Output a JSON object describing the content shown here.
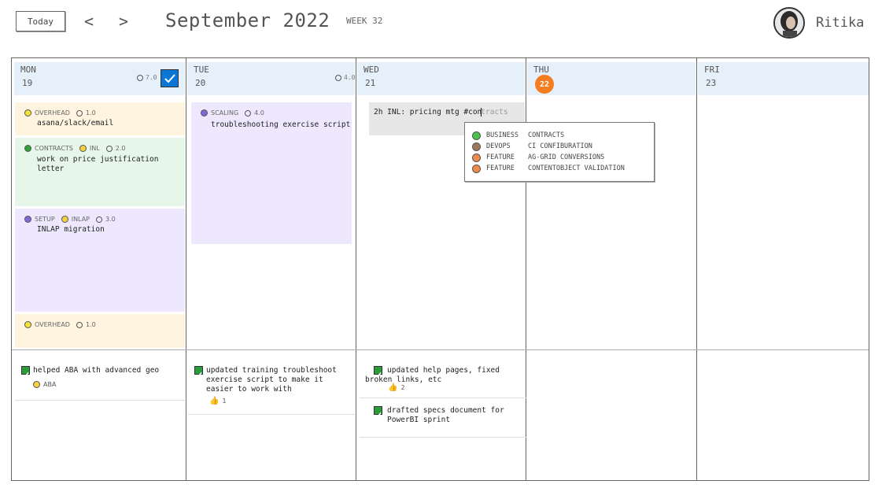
{
  "header": {
    "today_label": "Today",
    "prev_label": "<",
    "next_label": ">",
    "month_title": "September 2022",
    "week_label": "WEEK 32",
    "user_name": "Ritika"
  },
  "days": [
    {
      "name": "MON",
      "date": "19",
      "total": "7.0"
    },
    {
      "name": "TUE",
      "date": "20",
      "total": "4.0"
    },
    {
      "name": "WED",
      "date": "21"
    },
    {
      "name": "THU",
      "date": "22",
      "is_today": true
    },
    {
      "name": "FRI",
      "date": "23"
    }
  ],
  "tasks": {
    "mon": [
      {
        "tag": "OVERHEAD",
        "hours": "1.0",
        "title": "asana/slack/email",
        "color": "#f5e33a",
        "bg": "#fff4e0"
      },
      {
        "tag": "CONTRACTS",
        "person": "INL",
        "hours": "2.0",
        "title": "work on price justification letter",
        "color": "#2fa33a",
        "bg": "#e6f6e8"
      },
      {
        "tag": "SETUP",
        "person": "INLAP",
        "hours": "3.0",
        "title": "INLAP migration",
        "color": "#7d68d8",
        "bg": "#ede8fd"
      },
      {
        "tag": "OVERHEAD",
        "hours": "1.0",
        "color": "#f5e33a",
        "bg": "#fff4e0"
      }
    ],
    "tue": [
      {
        "tag": "SCALING",
        "hours": "4.0",
        "title": "troubleshooting exercise script",
        "color": "#7d68d8",
        "bg": "#ede8fd"
      }
    ]
  },
  "quick_entry": {
    "typed": "2h INL: pricing mtg #con",
    "completion": "tracts"
  },
  "suggestions": [
    {
      "category": "BUSINESS",
      "name": "CONTRACTS",
      "color": "#4cc24c"
    },
    {
      "category": "DEVOPS",
      "name": "CI CONFIBURATION",
      "color": "#a07858"
    },
    {
      "category": "FEATURE",
      "name": "AG-GRID CONVERSIONS",
      "color": "#f08a4a"
    },
    {
      "category": "FEATURE",
      "name": "CONTENTOBJECT VALIDATION",
      "color": "#f08a4a"
    }
  ],
  "done": {
    "mon": [
      {
        "text": "helped ABA with advanced geo",
        "person": "ABA"
      }
    ],
    "tue": [
      {
        "text": "updated training troubleshoot exercise script to make it easier to work with",
        "likes": "1"
      }
    ],
    "wed": [
      {
        "text": "updated help pages, fixed broken links, etc",
        "likes": "2"
      },
      {
        "text": "drafted specs document for PowerBI sprint"
      }
    ]
  }
}
